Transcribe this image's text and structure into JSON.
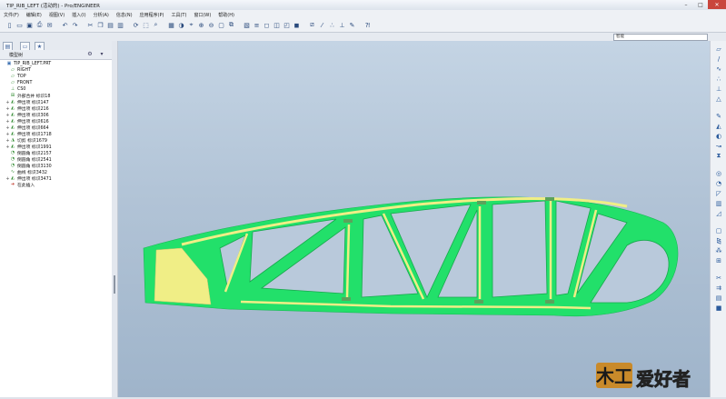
{
  "window": {
    "title": "TIP_RIB_LEFT (活动的) - Pro/ENGINEER"
  },
  "menu": [
    "文件(F)",
    "编辑(E)",
    "视图(V)",
    "插入(I)",
    "分析(A)",
    "信息(N)",
    "应用程序(P)",
    "工具(T)",
    "窗口(W)",
    "帮助(H)"
  ],
  "toolbar": {
    "icons": [
      "new-icon",
      "open-icon",
      "save-icon",
      "print-icon",
      "email-icon",
      "undo-icon",
      "redo-icon",
      "cut-icon",
      "copy-icon",
      "paste-icon",
      "paste-special-icon",
      "regenerate-icon",
      "select-icon",
      "find-icon",
      "repaint-icon",
      "shade-icon",
      "orient-icon",
      "zoom-in-icon",
      "zoom-out-icon",
      "refit-icon",
      "view-manager-icon",
      "saved-views-icon",
      "layers-icon",
      "wireframe-icon",
      "hidden-line-icon",
      "no-hidden-icon",
      "shading-icon",
      "datum-plane-icon",
      "datum-axis-icon",
      "datum-point-icon",
      "csys-icon",
      "annotation-icon",
      "help-icon"
    ]
  },
  "filter": {
    "value": "智能"
  },
  "panel": {
    "header": "模型树"
  },
  "tree": [
    {
      "label": "TIP_RIB_LEFT.PRT",
      "icon": "part-icon",
      "expand": ""
    },
    {
      "label": "RIGHT",
      "icon": "datum-plane-icon",
      "expand": ""
    },
    {
      "label": "TOP",
      "icon": "datum-plane-icon",
      "expand": ""
    },
    {
      "label": "FRONT",
      "icon": "datum-plane-icon",
      "expand": ""
    },
    {
      "label": "CS0",
      "icon": "csys-icon",
      "expand": ""
    },
    {
      "label": "外部合并 标识18",
      "icon": "merge-icon",
      "expand": ""
    },
    {
      "label": "伸出项 标识147",
      "icon": "extrude-icon",
      "expand": "+"
    },
    {
      "label": "伸出项 标识216",
      "icon": "extrude-icon",
      "expand": "+"
    },
    {
      "label": "伸出项 标识306",
      "icon": "extrude-icon",
      "expand": "+"
    },
    {
      "label": "伸出项 标识616",
      "icon": "extrude-icon",
      "expand": "+"
    },
    {
      "label": "伸出项 标识664",
      "icon": "extrude-icon",
      "expand": "+"
    },
    {
      "label": "伸出项 标识1718",
      "icon": "extrude-icon",
      "expand": "+"
    },
    {
      "label": "切剪 标识1679",
      "icon": "cut-icon",
      "expand": "+"
    },
    {
      "label": "伸出项 标识1991",
      "icon": "extrude-icon",
      "expand": "+"
    },
    {
      "label": "倒圆角 标识2157",
      "icon": "round-icon",
      "expand": ""
    },
    {
      "label": "倒圆角 标识2541",
      "icon": "round-icon",
      "expand": ""
    },
    {
      "label": "倒圆角 标识3130",
      "icon": "round-icon",
      "expand": ""
    },
    {
      "label": "曲线 标识3432",
      "icon": "curve-icon",
      "expand": ""
    },
    {
      "label": "伸出项 标识3471",
      "icon": "extrude-icon",
      "expand": "+"
    },
    {
      "label": "在此插入",
      "icon": "insert-here-icon",
      "expand": ""
    }
  ],
  "right_toolbar": [
    "datum-plane-icon",
    "datum-axis-icon",
    "datum-curve-icon",
    "datum-point-icon",
    "csys-icon",
    "analysis-icon",
    "sketch-icon",
    "extrude-icon",
    "revolve-icon",
    "sweep-icon",
    "blend-icon",
    "hole-icon",
    "round-icon",
    "chamfer-icon",
    "rib-icon",
    "draft-icon",
    "shell-icon",
    "mirror-icon",
    "pattern-icon",
    "merge-icon",
    "trim-icon",
    "offset-icon",
    "thicken-icon",
    "solidify-icon"
  ],
  "watermark": {
    "text": "爱好者",
    "glyph": "木工"
  },
  "colors": {
    "part_green": "#22e06a",
    "part_yellow": "#f0ee86",
    "viewport_top": "#c4d4e4",
    "viewport_bottom": "#9fb4ca"
  }
}
